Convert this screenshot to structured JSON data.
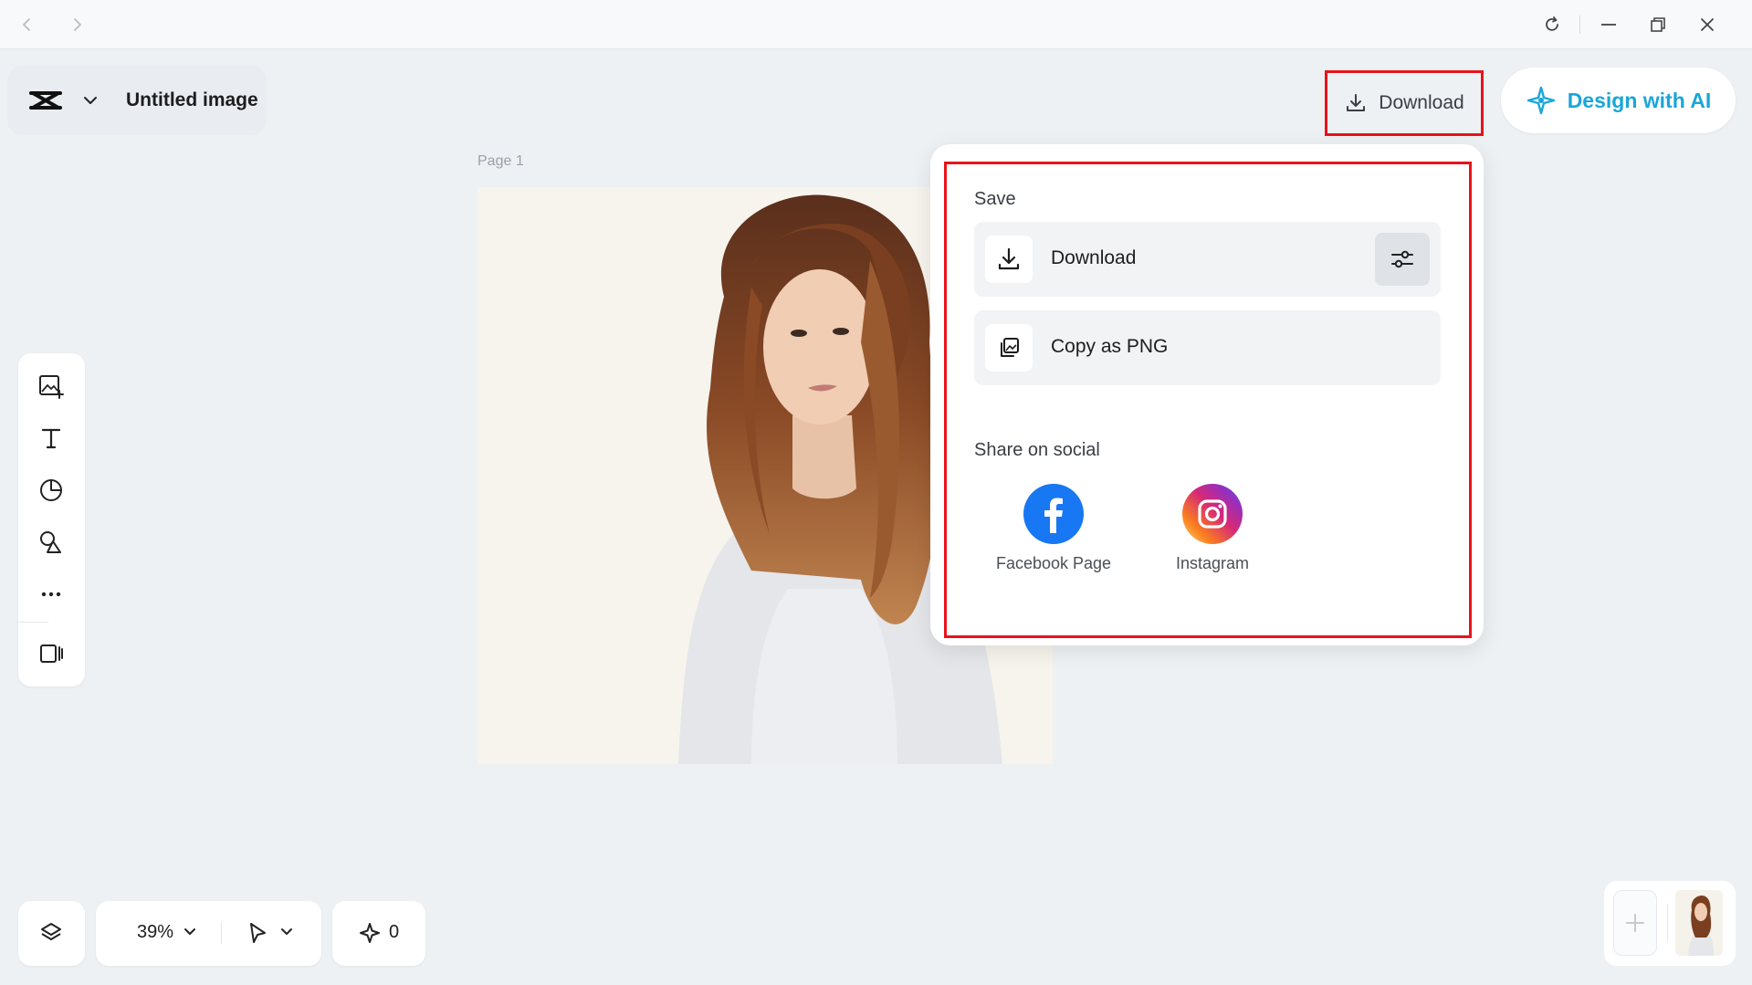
{
  "window": {
    "icons": [
      "back-icon",
      "forward-icon",
      "refresh-icon",
      "minimize-icon",
      "restore-icon",
      "close-icon"
    ]
  },
  "header": {
    "doc_title": "Untitled image",
    "download_label": "Download",
    "design_ai_label": "Design with AI"
  },
  "canvas": {
    "page_label": "Page 1"
  },
  "left_tools": [
    "add-image-icon",
    "text-icon",
    "sticker-icon",
    "shapes-icon",
    "more-icon",
    "panel-toggle-icon"
  ],
  "bottom": {
    "zoom": "39%",
    "credits": "0"
  },
  "download_menu": {
    "save_title": "Save",
    "download_label": "Download",
    "copy_label": "Copy as PNG",
    "share_title": "Share on social",
    "facebook_label": "Facebook Page",
    "instagram_label": "Instagram"
  },
  "colors": {
    "accent": "#1aa6d9",
    "highlight": "#e8131b",
    "facebook": "#1877f2"
  }
}
